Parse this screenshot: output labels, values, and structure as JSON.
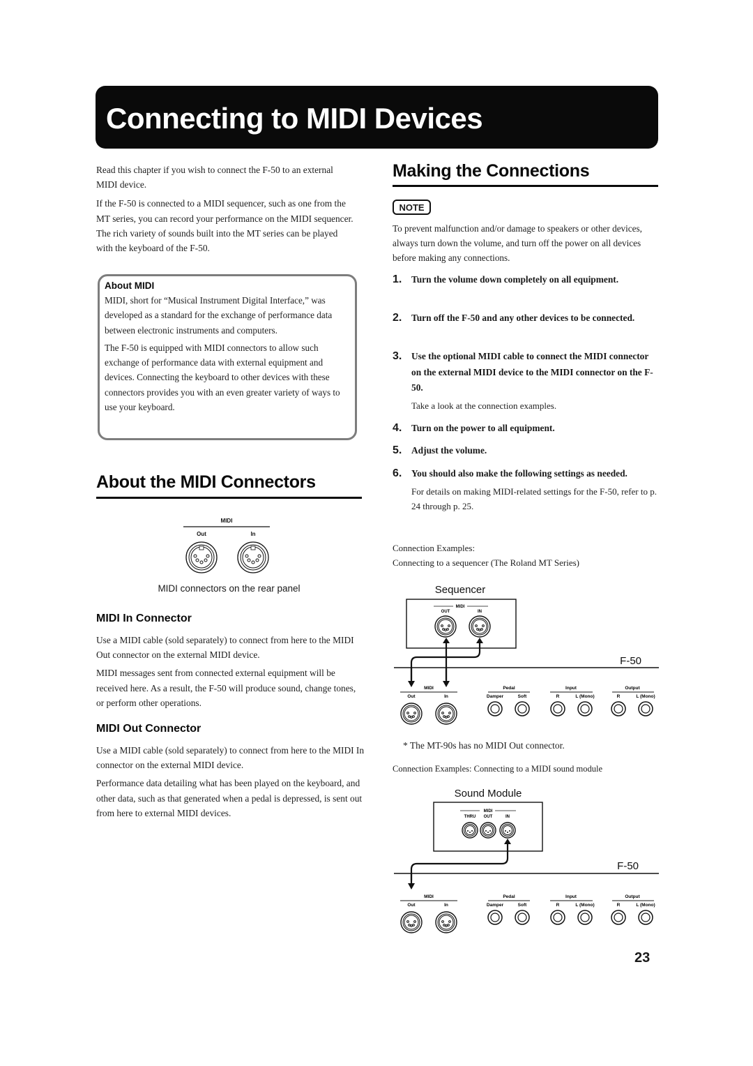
{
  "page": {
    "title": "Connecting to MIDI Devices",
    "page_number": "23"
  },
  "intro": {
    "paragraphs": [
      "Read this chapter if you wish to connect the F-50 to an external MIDI device.",
      "If the F-50 is connected to a MIDI sequencer, such as one from the MT series, you can record your performance on the MIDI sequencer. The rich variety of sounds built into the MT series can be played with the keyboard of the F-50."
    ]
  },
  "about_midi_box": {
    "title": "About MIDI",
    "paragraphs": [
      "MIDI, short for “Musical Instrument Digital Interface,” was developed as a standard for the exchange of performance data between electronic instruments and computers.",
      "The F-50 is equipped with MIDI connectors to allow such exchange of performance data with external equipment and devices. Connecting the keyboard to other devices with these connectors provides you with an even greater variety of ways to use your keyboard."
    ]
  },
  "about_connectors": {
    "heading": "About the MIDI Connectors",
    "figure": {
      "group_label": "MIDI",
      "ports": [
        "Out",
        "In"
      ],
      "caption": "MIDI connectors on the rear panel"
    },
    "midi_in": {
      "heading": "MIDI In Connector",
      "paragraphs": [
        "Use a MIDI cable (sold separately) to connect from here to the MIDI Out connector on the external MIDI device.",
        "MIDI messages sent from connected external equipment will be received here. As a result, the F-50 will produce sound, change tones, or perform other operations."
      ]
    },
    "midi_out": {
      "heading": "MIDI Out Connector",
      "paragraphs": [
        "Use a MIDI cable (sold separately) to connect from here to the MIDI In connector on the external MIDI device.",
        "Performance data detailing what has been played on the keyboard, and other data, such as that generated when a pedal is depressed, is sent out from here to external MIDI devices."
      ]
    }
  },
  "making_connections": {
    "heading": "Making the Connections",
    "note_label": "NOTE",
    "note_text": "To prevent malfunction and/or damage to speakers or other devices, always turn down the volume, and turn off the power on all devices before making any connections.",
    "steps": [
      {
        "num": "1.",
        "text": "Turn the volume down completely on all equipment.",
        "sub": ""
      },
      {
        "num": "2.",
        "text": "Turn off the F-50 and any other devices to be connected.",
        "sub": ""
      },
      {
        "num": "3.",
        "text": "Use the optional MIDI cable to connect the MIDI connector on the external MIDI device to the MIDI connector on the F-50.",
        "sub": "Take a look at the connection examples."
      },
      {
        "num": "4.",
        "text": "Turn on the power to all equipment.",
        "sub": ""
      },
      {
        "num": "5.",
        "text": "Adjust the volume.",
        "sub": ""
      },
      {
        "num": "6.",
        "text": "You should also make the following settings as needed.",
        "sub": "For details on making MIDI-related settings for the F-50, refer to p. 24 through p. 25."
      }
    ],
    "examples_label": "Connection Examples:",
    "example1_caption": "Connecting to a sequencer (The Roland MT Series)",
    "example1_device": "Sequencer",
    "example1_device_ports": {
      "group": "MIDI",
      "ports": [
        "OUT",
        "IN"
      ]
    },
    "example1_footnote": "* The MT-90s has no MIDI Out connector.",
    "example2_caption": "Connection Examples: Connecting to a MIDI sound module",
    "example2_device": "Sound Module",
    "example2_device_ports": {
      "group": "MIDI",
      "ports": [
        "THRU",
        "OUT",
        "IN"
      ]
    },
    "keyboard_label": "F-50",
    "keyboard_panel": {
      "midi": {
        "label": "MIDI",
        "ports": [
          "Out",
          "In"
        ]
      },
      "pedal": {
        "label": "Pedal",
        "ports": [
          "Damper",
          "Soft"
        ]
      },
      "input": {
        "label": "Input",
        "ports": [
          "R",
          "L (Mono)"
        ]
      },
      "output": {
        "label": "Output",
        "ports": [
          "R",
          "L (Mono)"
        ]
      }
    }
  }
}
